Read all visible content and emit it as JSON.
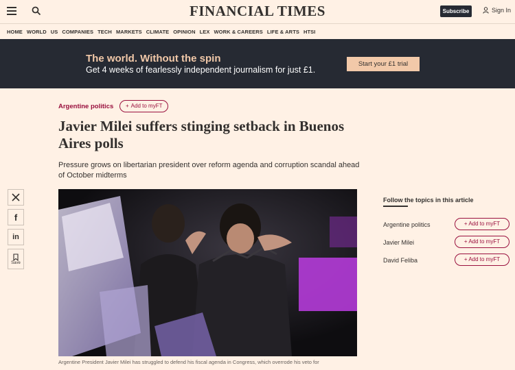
{
  "header": {
    "logo": "FINANCIAL TIMES",
    "subscribe_label": "Subscribe",
    "signin_label": "Sign In"
  },
  "nav": {
    "items": [
      "HOME",
      "WORLD",
      "US",
      "COMPANIES",
      "TECH",
      "MARKETS",
      "CLIMATE",
      "OPINION",
      "LEX",
      "WORK & CAREERS",
      "LIFE & ARTS",
      "HTSI"
    ]
  },
  "banner": {
    "headline": "The world. Without the spin",
    "subline": "Get 4 weeks of fearlessly independent journalism for just £1.",
    "cta_label": "Start your £1 trial"
  },
  "article": {
    "topic": "Argentine politics",
    "add_myft_label": "Add to myFT",
    "headline": "Javier Milei suffers stinging setback in Buenos Aires polls",
    "standfirst": "Pressure grows on libertarian president over reform agenda and corruption scandal ahead of October midterms",
    "caption": "Argentine President Javier Milei has struggled to defend his fiscal agenda in Congress, which overrode his veto for"
  },
  "share": {
    "save_label": "Save"
  },
  "follow": {
    "title": "Follow the topics in this article",
    "button_label": "Add to myFT",
    "topics": [
      "Argentine politics",
      "Javier Milei",
      "David Feliba"
    ]
  },
  "colors": {
    "page_bg": "#fff1e5",
    "banner_bg": "#262a33",
    "banner_accent": "#f2c9a9",
    "claret": "#990f3d",
    "text": "#33302e"
  }
}
